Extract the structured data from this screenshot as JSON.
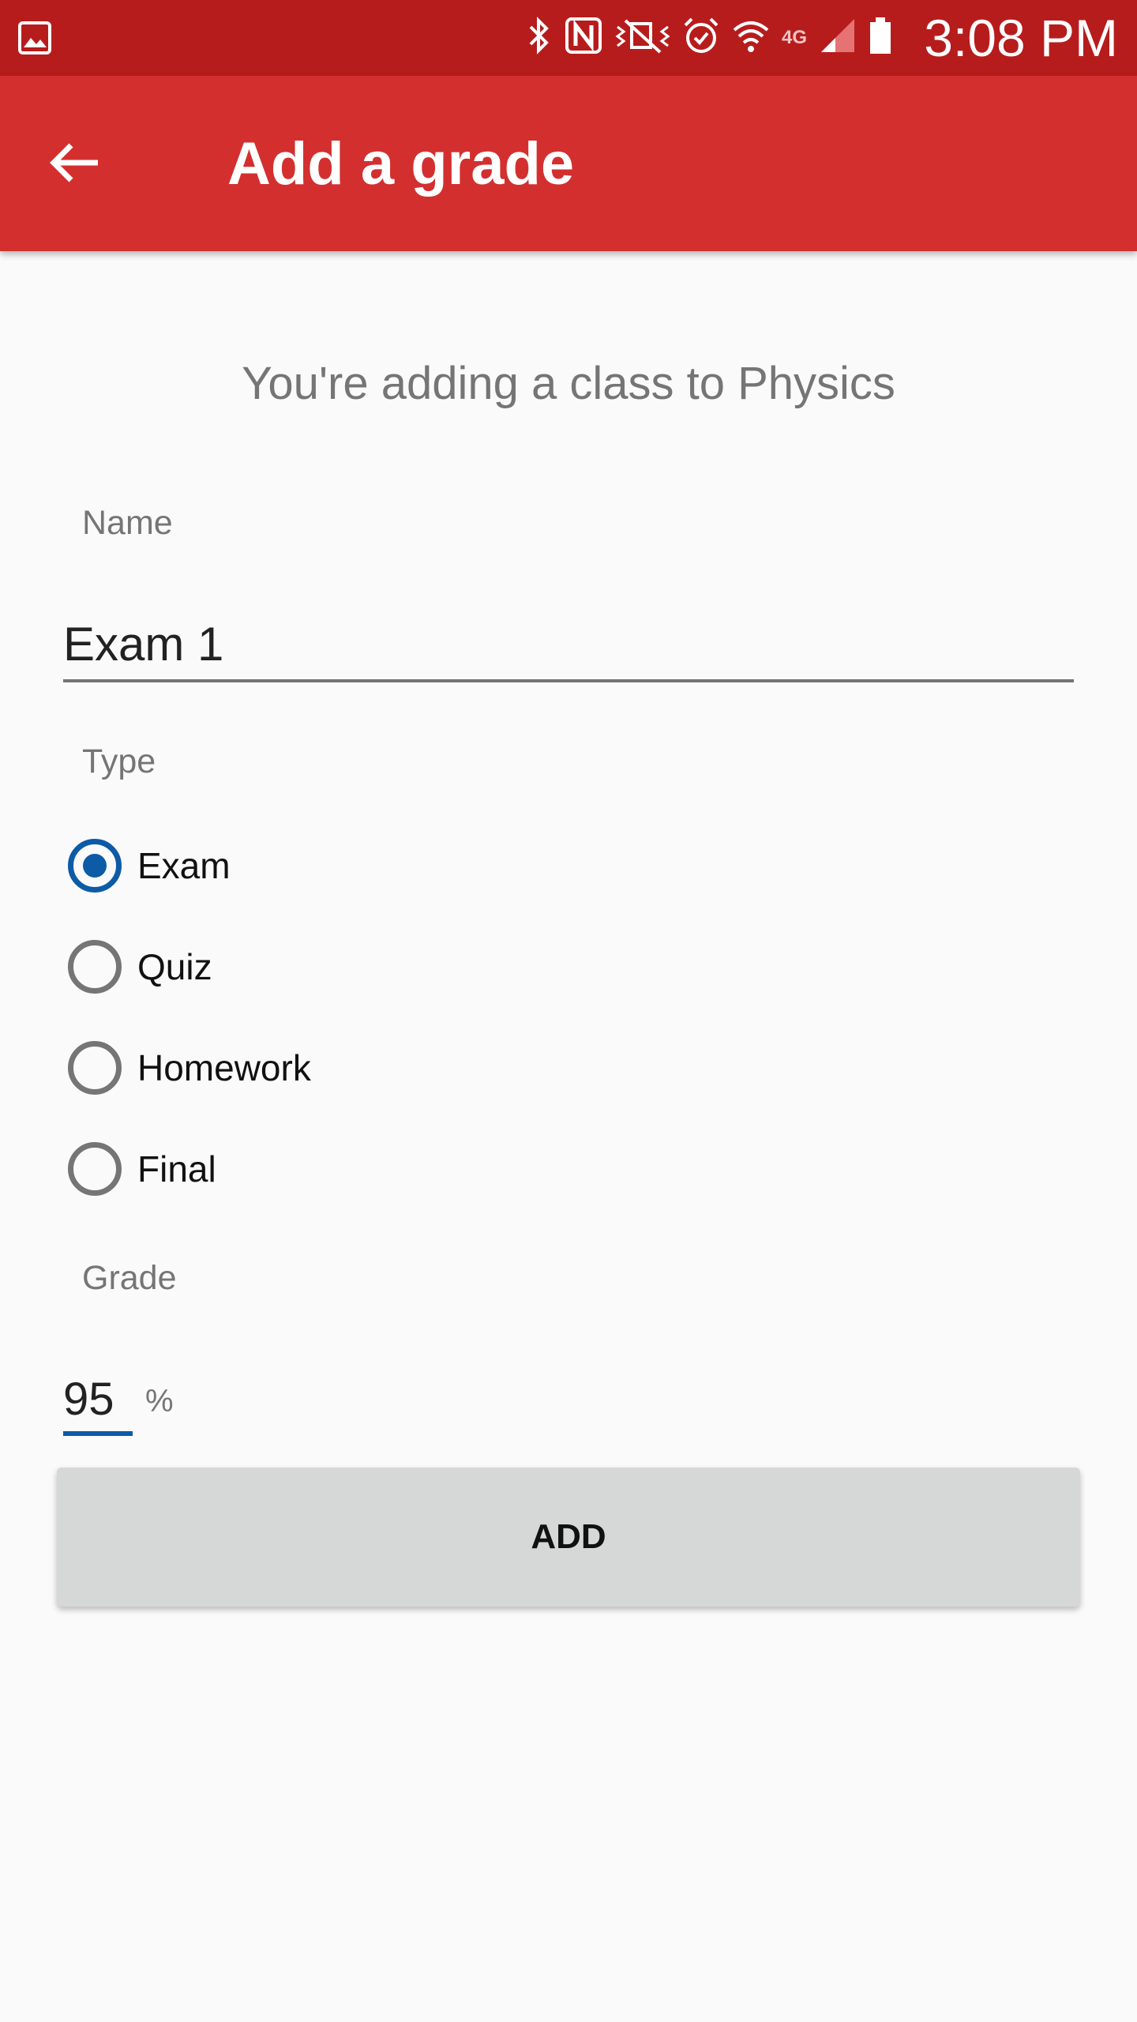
{
  "status_bar": {
    "time": "3:08 PM",
    "network": "4G"
  },
  "app_bar": {
    "title": "Add a grade"
  },
  "subtitle": "You're adding a class to Physics",
  "form": {
    "name_label": "Name",
    "name_value": "Exam 1",
    "type_label": "Type",
    "types": [
      {
        "label": "Exam",
        "checked": true
      },
      {
        "label": "Quiz",
        "checked": false
      },
      {
        "label": "Homework",
        "checked": false
      },
      {
        "label": "Final",
        "checked": false
      }
    ],
    "grade_label": "Grade",
    "grade_value": "95",
    "grade_unit": "%",
    "add_label": "ADD"
  },
  "colors": {
    "status_bar": "#b71c1c",
    "app_bar": "#d32f2f",
    "accent": "#0d5aa7"
  },
  "icons": [
    "gallery-icon",
    "bluetooth-icon",
    "nfc-icon",
    "mute-icon",
    "alarm-icon",
    "wifi-icon",
    "signal-icon",
    "battery-icon",
    "back-arrow-icon"
  ]
}
